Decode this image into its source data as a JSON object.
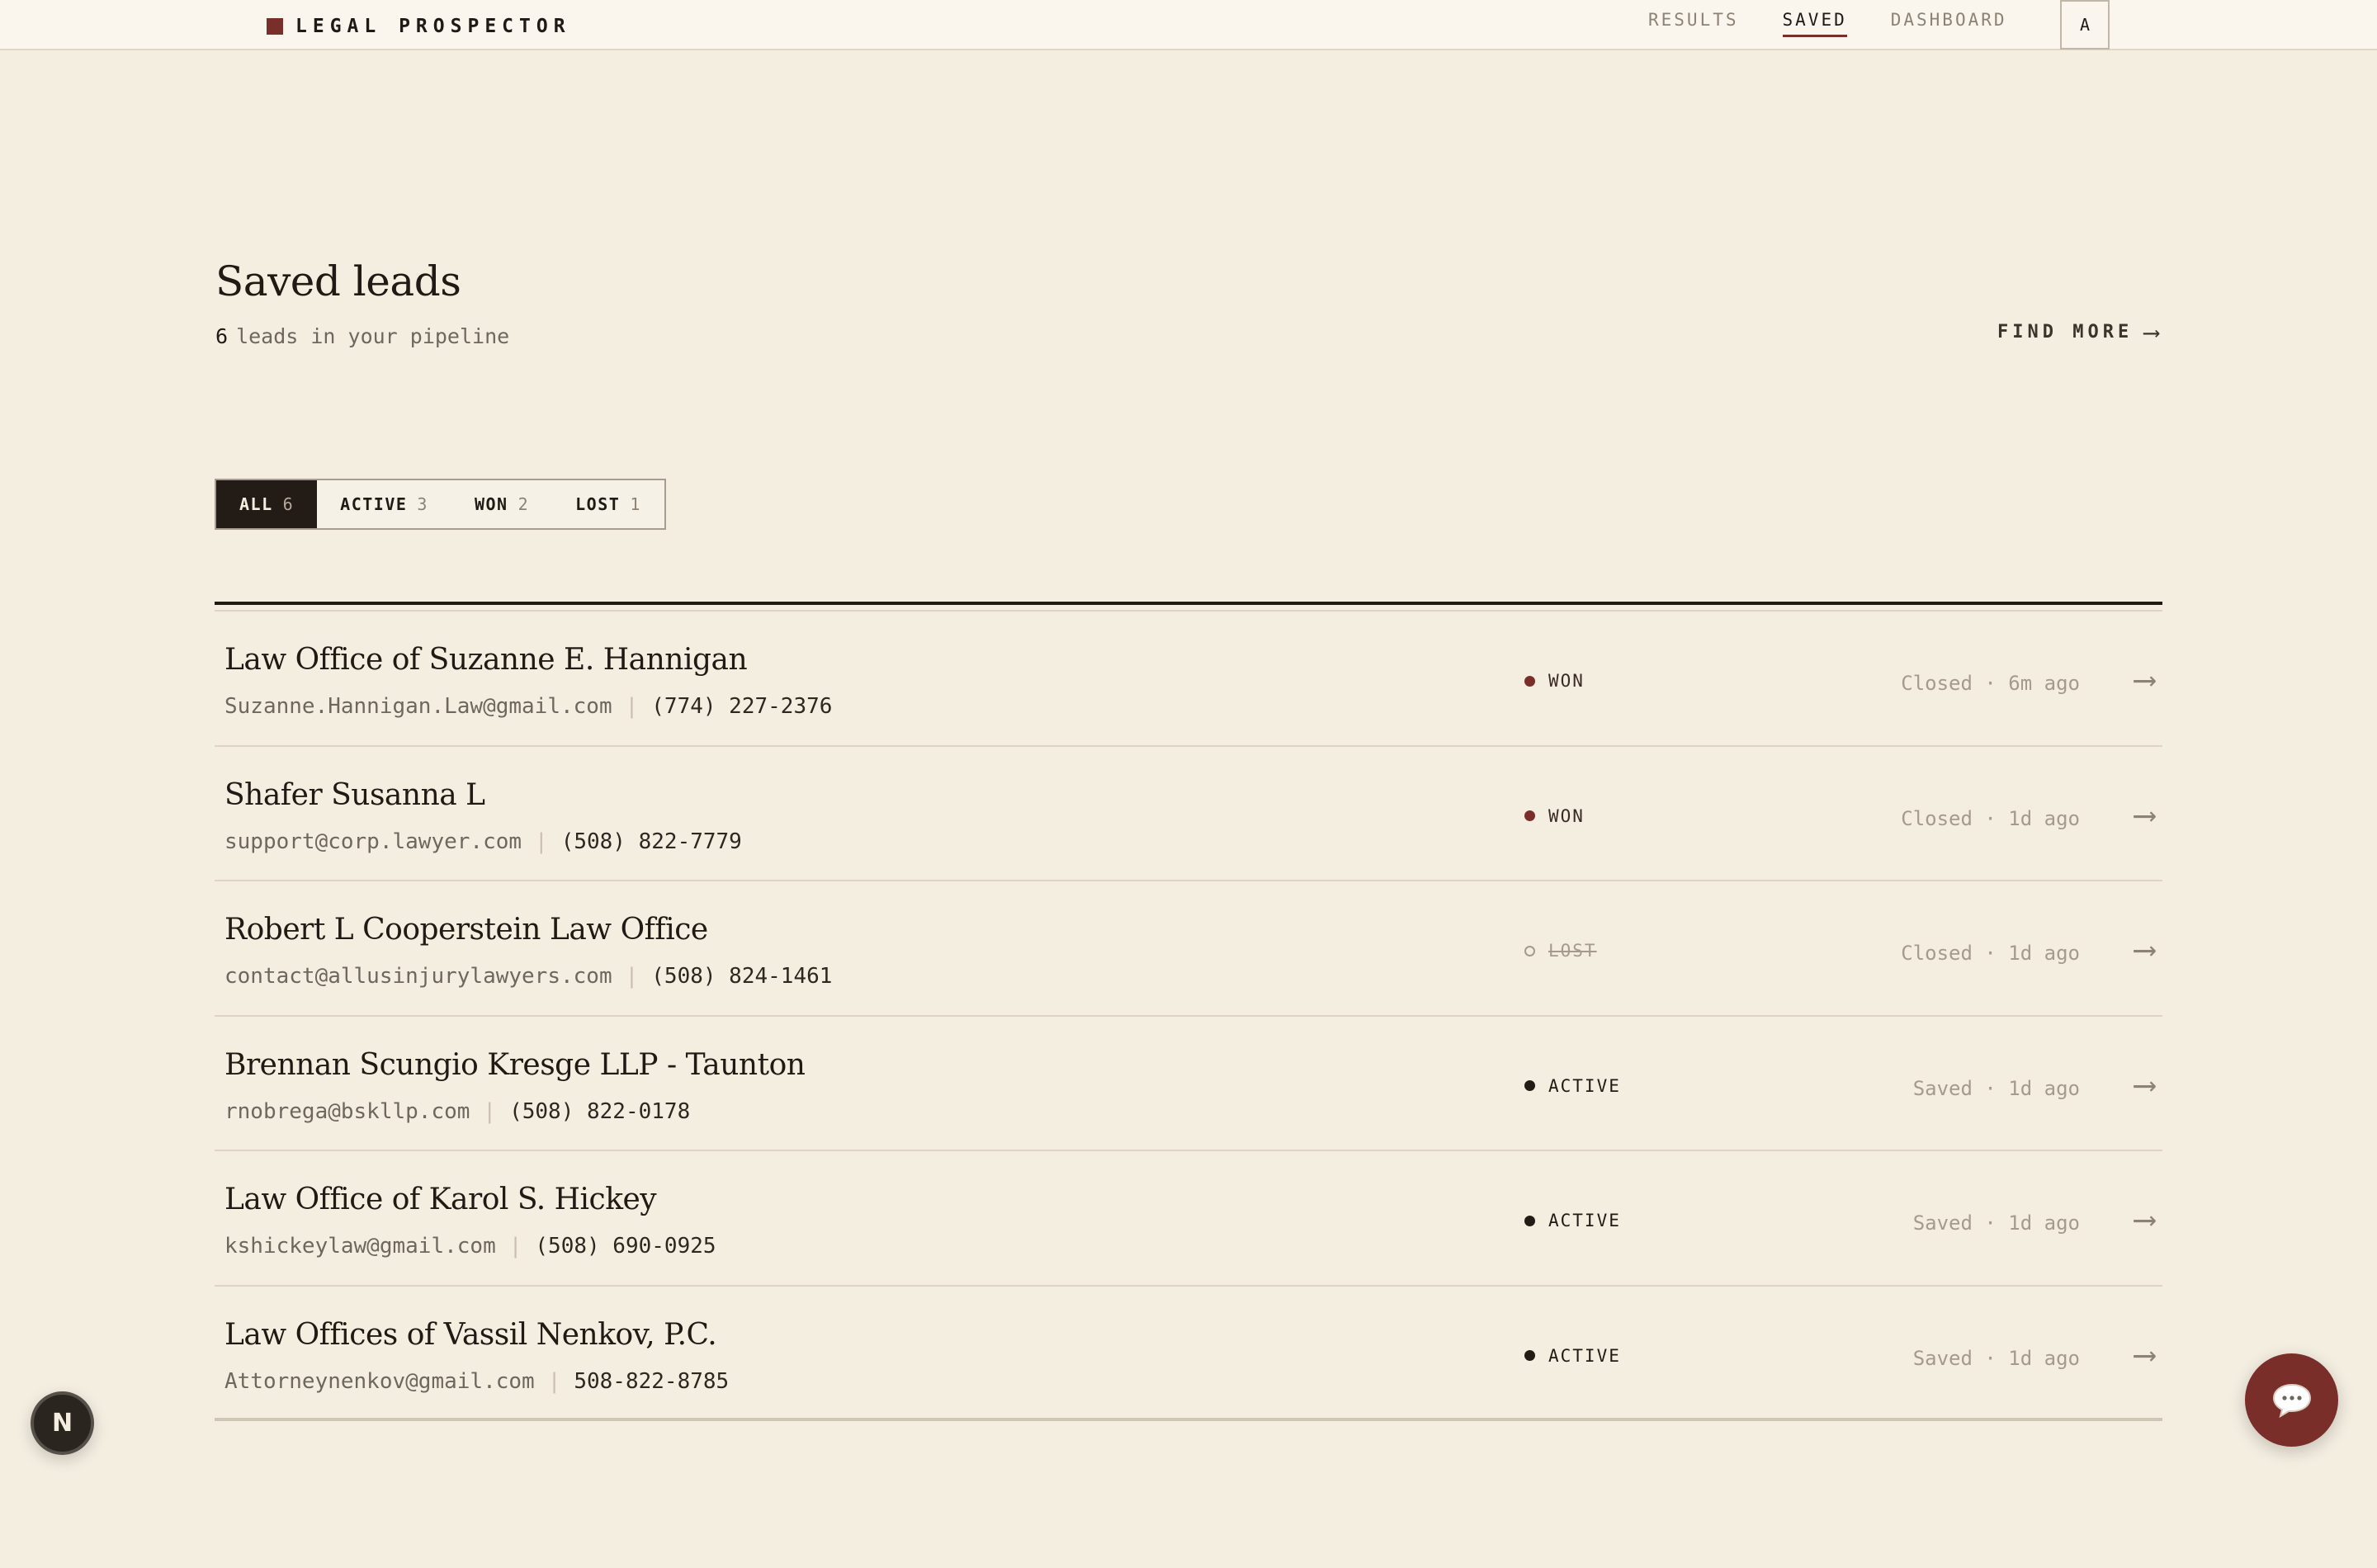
{
  "brand": {
    "name": "LEGAL PROSPECTOR"
  },
  "nav": {
    "items": [
      {
        "label": "RESULTS",
        "active": false
      },
      {
        "label": "SAVED",
        "active": true
      },
      {
        "label": "DASHBOARD",
        "active": false
      }
    ],
    "avatar": "A"
  },
  "header": {
    "title": "Saved leads",
    "count": "6",
    "subtitle": "leads in your pipeline",
    "find_more": "FIND MORE",
    "find_more_arrow": "⟶"
  },
  "filters": [
    {
      "label": "ALL",
      "count": "6",
      "active": true
    },
    {
      "label": "ACTIVE",
      "count": "3",
      "active": false
    },
    {
      "label": "WON",
      "count": "2",
      "active": false
    },
    {
      "label": "LOST",
      "count": "1",
      "active": false
    }
  ],
  "leads": [
    {
      "name": "Law Office of Suzanne E. Hannigan",
      "email": "Suzanne.Hannigan.Law@gmail.com",
      "phone": "(774) 227-2376",
      "status": "WON",
      "meta": "Closed · 6m ago"
    },
    {
      "name": "Shafer Susanna L",
      "email": "support@corp.lawyer.com",
      "phone": "(508) 822-7779",
      "status": "WON",
      "meta": "Closed · 1d ago"
    },
    {
      "name": "Robert L Cooperstein Law Office",
      "email": "contact@allusinjurylawyers.com",
      "phone": "(508) 824-1461",
      "status": "LOST",
      "meta": "Closed · 1d ago"
    },
    {
      "name": "Brennan Scungio Kresge LLP - Taunton",
      "email": "rnobrega@bskllp.com",
      "phone": "(508) 822-0178",
      "status": "ACTIVE",
      "meta": "Saved · 1d ago"
    },
    {
      "name": "Law Office of Karol S. Hickey",
      "email": "kshickeylaw@gmail.com",
      "phone": "(508) 690-0925",
      "status": "ACTIVE",
      "meta": "Saved · 1d ago"
    },
    {
      "name": "Law Offices of Vassil Nenkov, P.C.",
      "email": "Attorneynenkov@gmail.com",
      "phone": "508-822-8785",
      "status": "ACTIVE",
      "meta": "Saved · 1d ago"
    }
  ],
  "row_arrow": "⟶",
  "floating": {
    "dev_badge": "N",
    "chat_icon": "chat-bubble-icon"
  },
  "colors": {
    "accent": "#7a2e2a",
    "background": "#f4eee1",
    "ink": "#1f1a14"
  }
}
